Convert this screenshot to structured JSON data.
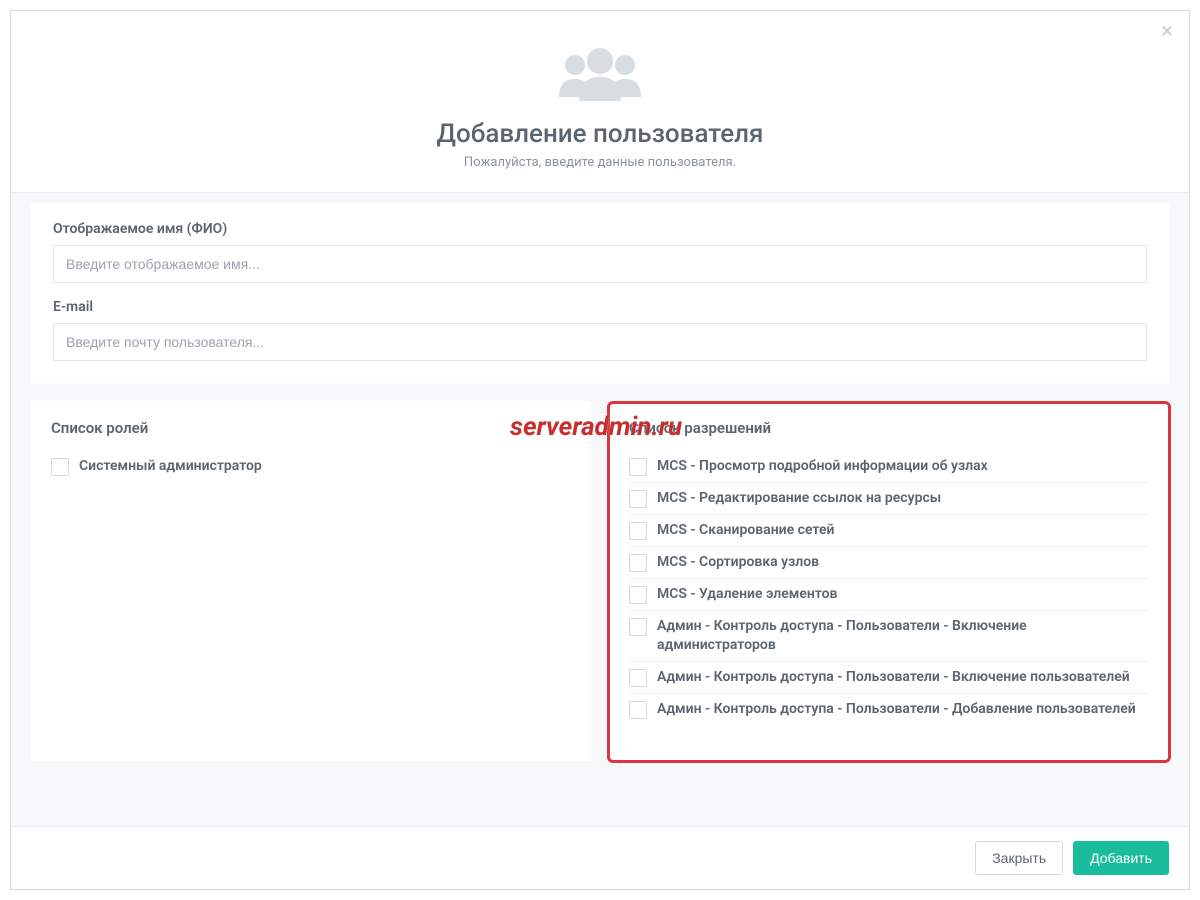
{
  "header": {
    "title": "Добавление пользователя",
    "subtitle": "Пожалуйста, введите данные пользователя."
  },
  "close_label": "×",
  "form": {
    "display_name": {
      "label": "Отображаемое имя (ФИО)",
      "placeholder": "Введите отображаемое имя...",
      "value": ""
    },
    "email": {
      "label": "E-mail",
      "placeholder": "Введите почту пользователя...",
      "value": ""
    }
  },
  "roles": {
    "title": "Список ролей",
    "items": [
      {
        "label": "Системный администратор"
      }
    ]
  },
  "permissions": {
    "title": "Список разрешений",
    "items": [
      {
        "label": "MCS - Просмотр подробной информации об узлах"
      },
      {
        "label": "MCS - Редактирование ссылок на ресурсы"
      },
      {
        "label": "MCS - Сканирование сетей"
      },
      {
        "label": "MCS - Сортировка узлов"
      },
      {
        "label": "MCS - Удаление элементов"
      },
      {
        "label": "Админ - Контроль доступа - Пользователи - Включение администраторов"
      },
      {
        "label": "Админ - Контроль доступа - Пользователи - Включение пользователей"
      },
      {
        "label": "Админ - Контроль доступа - Пользователи - Добавление пользователей"
      }
    ]
  },
  "footer": {
    "close": "Закрыть",
    "add": "Добавить"
  },
  "watermark": "serveradmin.ru"
}
